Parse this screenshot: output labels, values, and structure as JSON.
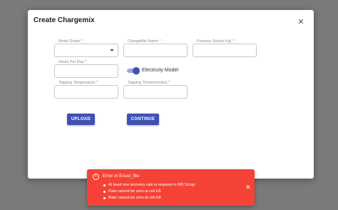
{
  "dialog": {
    "title": "Create Chargemix",
    "close_icon": "close-icon",
    "fields": {
      "metal_grade": {
        "label": "Metal Grade *",
        "value": ""
      },
      "chargemix_name": {
        "label": "ChargeMix Name *",
        "value": ""
      },
      "furnace_size": {
        "label": "Furnace Size(in Kg) *",
        "value": ""
      },
      "heats_per_day": {
        "label": "Heats Per Day *",
        "value": ""
      },
      "tapping_temperature": {
        "label": "Tapping Temperature *",
        "value": ""
      },
      "tapping_time": {
        "label": "Tapping Time(minutes) *",
        "value": ""
      }
    },
    "electricity_model": {
      "label": "Electricity Model",
      "enabled": true
    },
    "buttons": {
      "upload": "UPLOAD",
      "continue": "CONTINUE"
    }
  },
  "toast": {
    "icon": "error-circle-icon",
    "title": "Error in Excel_file",
    "messages": [
      "At least one recovery rate is required in MS Scrap",
      "Rate cannot be zero at cell E5",
      "Rate cannot be zero at cell E8"
    ],
    "close_icon": "close-icon"
  },
  "colors": {
    "primary": "#3f51b5",
    "error": "#f44336",
    "overlay": "#7a7a7a"
  }
}
